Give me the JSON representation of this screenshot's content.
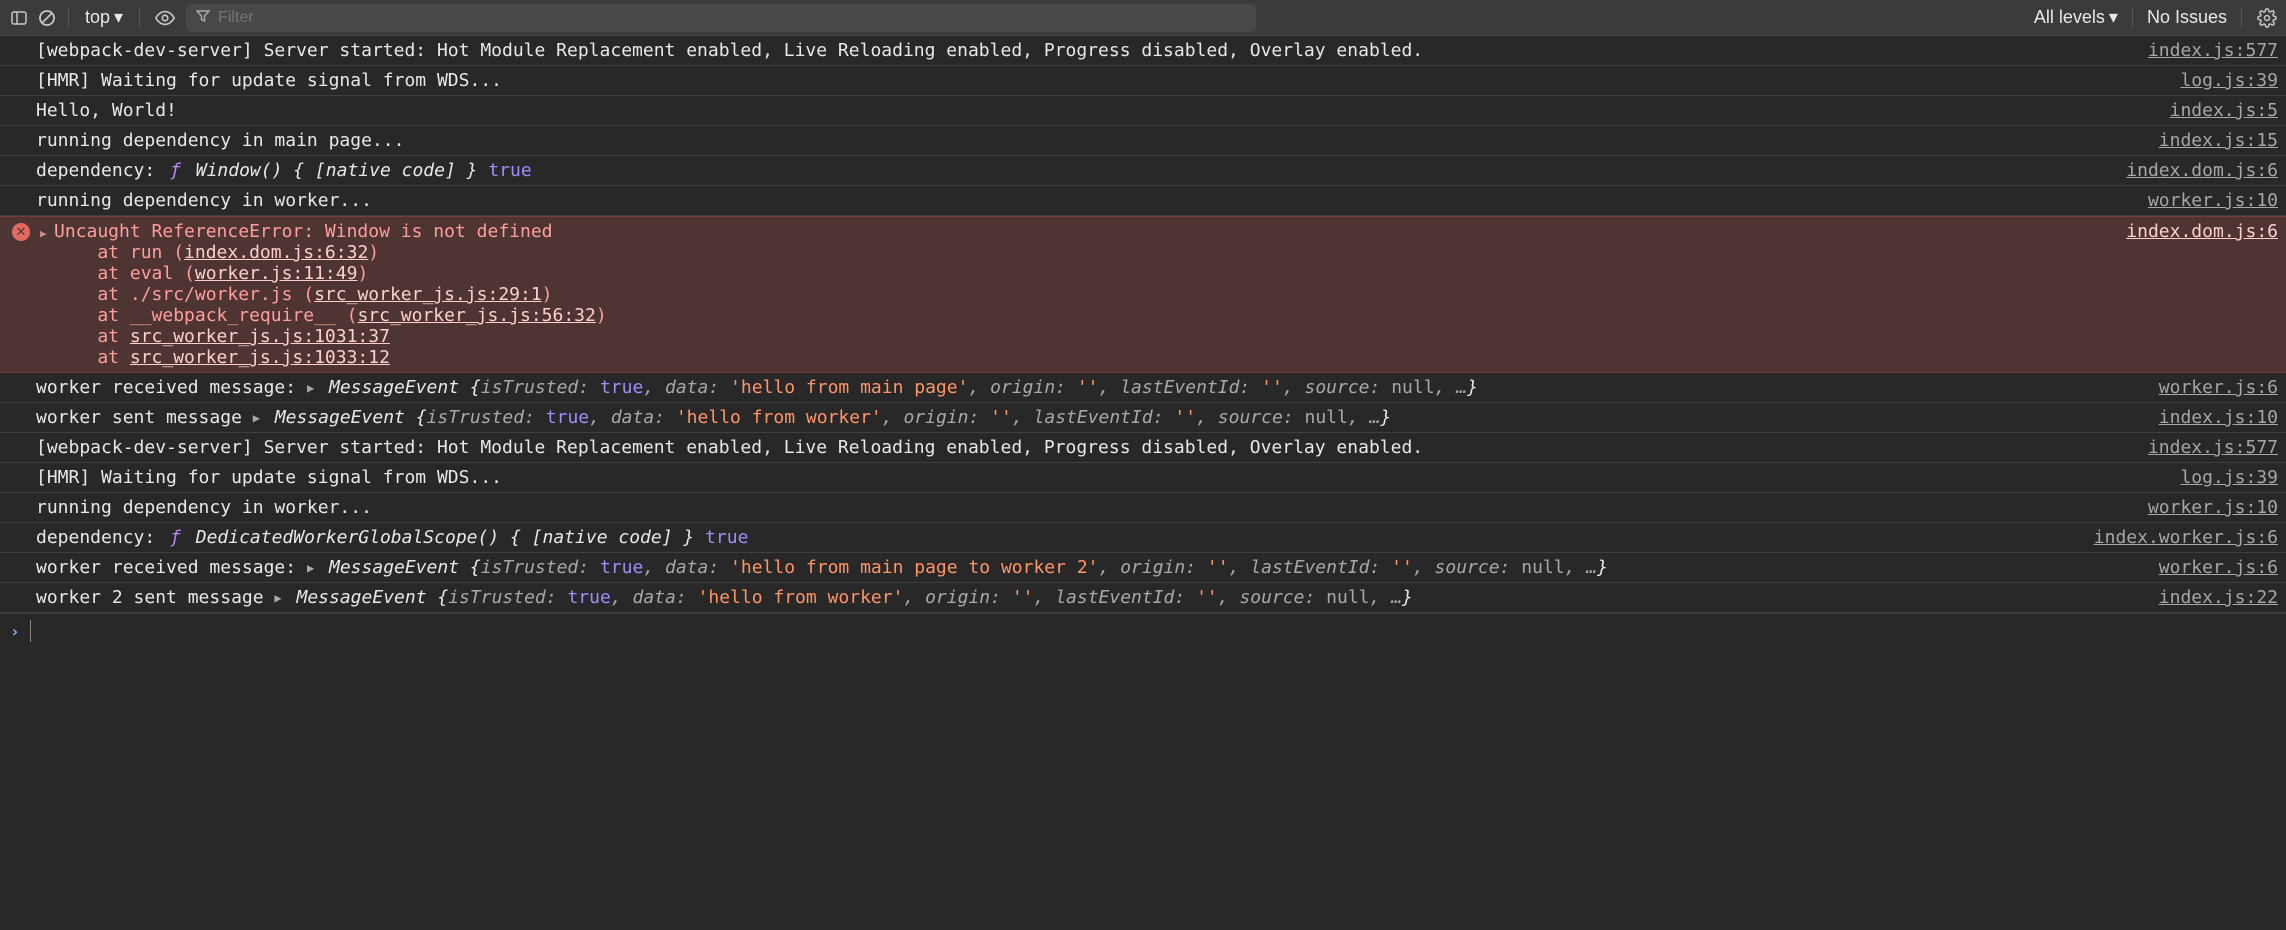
{
  "toolbar": {
    "context": "top",
    "filter_placeholder": "Filter",
    "levels_label": "All levels",
    "issues_label": "No Issues"
  },
  "rows": [
    {
      "type": "log",
      "text": "[webpack-dev-server] Server started: Hot Module Replacement enabled, Live Reloading enabled, Progress disabled, Overlay enabled.",
      "source": "index.js:577"
    },
    {
      "type": "log",
      "text": "[HMR] Waiting for update signal from WDS...",
      "source": "log.js:39"
    },
    {
      "type": "log",
      "text": "Hello, World!",
      "source": "index.js:5"
    },
    {
      "type": "log",
      "text": "running dependency in main page...",
      "source": "index.js:15"
    },
    {
      "type": "fn",
      "prefix": "dependency:",
      "fn_sig": "Window() { [native code] }",
      "bool": "true",
      "source": "index.dom.js:6"
    },
    {
      "type": "log",
      "text": "running dependency in worker...",
      "source": "worker.js:10"
    },
    {
      "type": "error",
      "header": "Uncaught ReferenceError: Window is not defined",
      "stack": [
        {
          "pre": "    at run (",
          "link": "index.dom.js:6:32",
          "post": ")"
        },
        {
          "pre": "    at eval (",
          "link": "worker.js:11:49",
          "post": ")"
        },
        {
          "pre": "    at ./src/worker.js (",
          "link": "src_worker_js.js:29:1",
          "post": ")"
        },
        {
          "pre": "    at __webpack_require__ (",
          "link": "src_worker_js.js:56:32",
          "post": ")"
        },
        {
          "pre": "    at ",
          "link": "src_worker_js.js:1031:37",
          "post": ""
        },
        {
          "pre": "    at ",
          "link": "src_worker_js.js:1033:12",
          "post": ""
        }
      ],
      "source": "index.dom.js:6"
    },
    {
      "type": "msgevent",
      "prefix": "worker received message:",
      "obj_type": "MessageEvent",
      "props": [
        {
          "k": "isTrusted",
          "v": "true",
          "t": "bool"
        },
        {
          "k": "data",
          "v": "'hello from main page'",
          "t": "str"
        },
        {
          "k": "origin",
          "v": "''",
          "t": "str"
        },
        {
          "k": "lastEventId",
          "v": "''",
          "t": "str"
        },
        {
          "k": "source",
          "v": "null",
          "t": "null"
        }
      ],
      "source": "worker.js:6"
    },
    {
      "type": "msgevent",
      "prefix": "worker sent message",
      "obj_type": "MessageEvent",
      "props": [
        {
          "k": "isTrusted",
          "v": "true",
          "t": "bool"
        },
        {
          "k": "data",
          "v": "'hello from worker'",
          "t": "str"
        },
        {
          "k": "origin",
          "v": "''",
          "t": "str"
        },
        {
          "k": "lastEventId",
          "v": "''",
          "t": "str"
        },
        {
          "k": "source",
          "v": "null",
          "t": "null"
        }
      ],
      "source": "index.js:10"
    },
    {
      "type": "log",
      "text": "[webpack-dev-server] Server started: Hot Module Replacement enabled, Live Reloading enabled, Progress disabled, Overlay enabled.",
      "source": "index.js:577"
    },
    {
      "type": "log",
      "text": "[HMR] Waiting for update signal from WDS...",
      "source": "log.js:39"
    },
    {
      "type": "log",
      "text": "running dependency in worker...",
      "source": "worker.js:10"
    },
    {
      "type": "fn",
      "prefix": "dependency:",
      "fn_sig": "DedicatedWorkerGlobalScope() { [native code] }",
      "bool": "true",
      "source": "index.worker.js:6"
    },
    {
      "type": "msgevent",
      "prefix": "worker received message:",
      "obj_type": "MessageEvent",
      "props": [
        {
          "k": "isTrusted",
          "v": "true",
          "t": "bool"
        },
        {
          "k": "data",
          "v": "'hello from main page to worker 2'",
          "t": "str"
        },
        {
          "k": "origin",
          "v": "''",
          "t": "str"
        },
        {
          "k": "lastEventId",
          "v": "''",
          "t": "str"
        },
        {
          "k": "source",
          "v": "null",
          "t": "null"
        }
      ],
      "source": "worker.js:6"
    },
    {
      "type": "msgevent",
      "prefix": "worker 2 sent message",
      "obj_type": "MessageEvent",
      "props": [
        {
          "k": "isTrusted",
          "v": "true",
          "t": "bool"
        },
        {
          "k": "data",
          "v": "'hello from worker'",
          "t": "str"
        },
        {
          "k": "origin",
          "v": "''",
          "t": "str"
        },
        {
          "k": "lastEventId",
          "v": "''",
          "t": "str"
        },
        {
          "k": "source",
          "v": "null",
          "t": "null"
        }
      ],
      "source": "index.js:22"
    }
  ]
}
